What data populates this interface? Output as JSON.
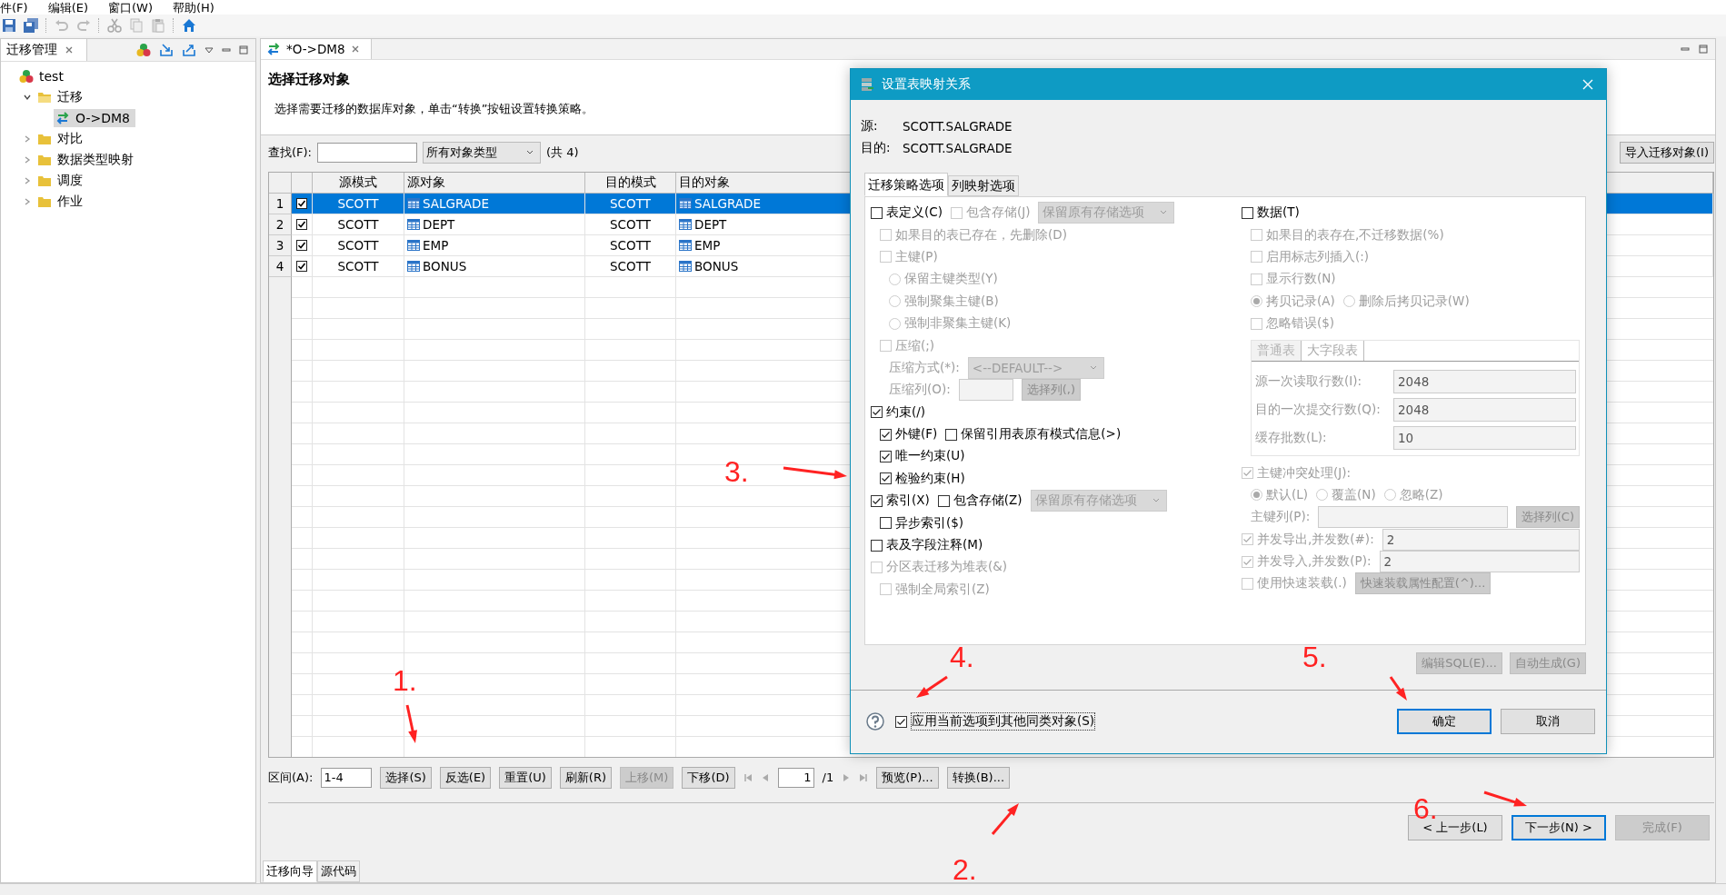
{
  "menu": [
    "件(F)",
    "编辑(E)",
    "窗口(W)",
    "帮助(H)"
  ],
  "left_panel": {
    "title": "迁移管理",
    "tree": [
      {
        "label": "test",
        "kind": "project",
        "selected": false,
        "children": [
          {
            "label": "迁移",
            "kind": "folder",
            "expanded": true,
            "selected": false,
            "children": [
              {
                "label": "O->DM8",
                "kind": "migration",
                "selected": true
              }
            ]
          },
          {
            "label": "对比",
            "kind": "folder",
            "expanded": false,
            "selected": false
          },
          {
            "label": "数据类型映射",
            "kind": "folder",
            "expanded": false,
            "selected": false
          },
          {
            "label": "调度",
            "kind": "folder",
            "expanded": false,
            "selected": false
          },
          {
            "label": "作业",
            "kind": "folder",
            "expanded": false,
            "selected": false
          }
        ]
      }
    ]
  },
  "editor": {
    "tab": "*O->DM8",
    "heading": "选择迁移对象",
    "description": "选择需要迁移的数据库对象，单击“转换”按钮设置转换策略。",
    "search_label": "查找(F):",
    "type_filter": "所有对象类型",
    "count": "(共 4)",
    "import_button": "导入迁移对象(I)"
  },
  "table": {
    "columns": [
      "源模式",
      "源对象",
      "目的模式",
      "目的对象"
    ],
    "rows": [
      {
        "index": "1",
        "checked": true,
        "selected": true,
        "source_schema": "SCOTT",
        "source_object": "SALGRADE",
        "target_schema": "SCOTT",
        "target_object": "SALGRADE"
      },
      {
        "index": "2",
        "checked": true,
        "selected": false,
        "source_schema": "SCOTT",
        "source_object": "DEPT",
        "target_schema": "SCOTT",
        "target_object": "DEPT"
      },
      {
        "index": "3",
        "checked": true,
        "selected": false,
        "source_schema": "SCOTT",
        "source_object": "EMP",
        "target_schema": "SCOTT",
        "target_object": "EMP"
      },
      {
        "index": "4",
        "checked": true,
        "selected": false,
        "source_schema": "SCOTT",
        "source_object": "BONUS",
        "target_schema": "SCOTT",
        "target_object": "BONUS"
      }
    ]
  },
  "pager": {
    "range_label": "区间(A):",
    "range_value": "1-4",
    "buttons": [
      {
        "label": "选择(S)",
        "disabled": false
      },
      {
        "label": "反选(E)",
        "disabled": false
      },
      {
        "label": "重置(U)",
        "disabled": false
      },
      {
        "label": "刷新(R)",
        "disabled": false
      },
      {
        "label": "上移(M)",
        "disabled": true
      },
      {
        "label": "下移(D)",
        "disabled": false
      }
    ],
    "page": "1",
    "pages": "/1",
    "actions": [
      {
        "label": "预览(P)...",
        "disabled": false
      },
      {
        "label": "转换(B)...",
        "disabled": false
      }
    ]
  },
  "wizard_buttons": [
    {
      "label": "< 上一步(L)",
      "disabled": false,
      "default": false
    },
    {
      "label": "下一步(N) >",
      "disabled": false,
      "default": true
    },
    {
      "label": "完成(F)",
      "disabled": true,
      "default": false
    }
  ],
  "bottom_tabs": [
    {
      "label": "迁移向导",
      "selected": true
    },
    {
      "label": "源代码",
      "selected": false
    }
  ],
  "dialog": {
    "title": "设置表映射关系",
    "source_label": "源:",
    "source": "SCOTT.SALGRADE",
    "target_label": "目的:",
    "target": "SCOTT.SALGRADE",
    "tabs": [
      {
        "label": "迁移策略选项",
        "selected": true
      },
      {
        "label": "列映射选项",
        "selected": false
      }
    ],
    "left": [
      {
        "controls": [
          {
            "kind": "checkbox",
            "label": "表定义(C)",
            "checked": false,
            "disabled": false
          },
          {
            "kind": "checkbox",
            "label": "包含存储(J)",
            "checked": false,
            "disabled": true
          },
          {
            "kind": "select",
            "value": "保留原有存储选项",
            "disabled": true
          }
        ],
        "children": [
          {
            "controls": [
              {
                "kind": "checkbox",
                "label": "如果目的表已存在，先删除(D)",
                "checked": false,
                "disabled": true
              }
            ]
          },
          {
            "controls": [
              {
                "kind": "checkbox",
                "label": "主键(P)",
                "checked": false,
                "disabled": true
              }
            ],
            "children": [
              {
                "controls": [
                  {
                    "kind": "radio",
                    "label": "保留主键类型(Y)",
                    "selected": false,
                    "disabled": true
                  }
                ]
              },
              {
                "controls": [
                  {
                    "kind": "radio",
                    "label": "强制聚集主键(B)",
                    "selected": false,
                    "disabled": true
                  }
                ]
              },
              {
                "controls": [
                  {
                    "kind": "radio",
                    "label": "强制非聚集主键(K)",
                    "selected": false,
                    "disabled": true
                  }
                ]
              }
            ]
          },
          {
            "controls": [
              {
                "kind": "checkbox",
                "label": "压缩(;)",
                "checked": false,
                "disabled": true
              }
            ],
            "children": [
              {
                "controls": [
                  {
                    "kind": "label",
                    "label": "压缩方式(*):",
                    "disabled": true
                  },
                  {
                    "kind": "select",
                    "value": "<--DEFAULT-->",
                    "disabled": true
                  }
                ]
              },
              {
                "controls": [
                  {
                    "kind": "label",
                    "label": "压缩列(O):",
                    "disabled": true
                  },
                  {
                    "kind": "input",
                    "disabled": true
                  },
                  {
                    "kind": "button",
                    "label": "选择列(,)",
                    "disabled": true
                  }
                ]
              }
            ]
          }
        ]
      },
      {
        "controls": [
          {
            "kind": "checkbox",
            "label": "约束(/)",
            "checked": true,
            "disabled": false
          }
        ],
        "children": [
          {
            "controls": [
              {
                "kind": "checkbox",
                "label": "外键(F)",
                "checked": true,
                "disabled": false
              },
              {
                "kind": "checkbox",
                "label": "保留引用表原有模式信息(>)",
                "checked": false,
                "disabled": false
              }
            ]
          },
          {
            "controls": [
              {
                "kind": "checkbox",
                "label": "唯一约束(U)",
                "checked": true,
                "disabled": false
              }
            ]
          },
          {
            "controls": [
              {
                "kind": "checkbox",
                "label": "检验约束(H)",
                "checked": true,
                "disabled": false
              }
            ]
          }
        ]
      },
      {
        "controls": [
          {
            "kind": "checkbox",
            "label": "索引(X)",
            "checked": true,
            "disabled": false
          },
          {
            "kind": "checkbox",
            "label": "包含存储(Z)",
            "checked": false,
            "disabled": false
          },
          {
            "kind": "select",
            "value": "保留原有存储选项",
            "disabled": true
          }
        ],
        "children": [
          {
            "controls": [
              {
                "kind": "checkbox",
                "label": "异步索引($)",
                "checked": false,
                "disabled": false
              }
            ]
          }
        ]
      },
      {
        "controls": [
          {
            "kind": "checkbox",
            "label": "表及字段注释(M)",
            "checked": false,
            "disabled": false
          }
        ]
      },
      {
        "controls": [
          {
            "kind": "checkbox",
            "label": "分区表迁移为堆表(&)",
            "checked": false,
            "disabled": true
          }
        ],
        "children": [
          {
            "controls": [
              {
                "kind": "checkbox",
                "label": "强制全局索引(Z)",
                "checked": false,
                "disabled": true
              }
            ]
          }
        ]
      }
    ],
    "right_top": [
      {
        "controls": [
          {
            "kind": "checkbox",
            "label": "数据(T)",
            "checked": false,
            "disabled": false
          }
        ],
        "children": [
          {
            "controls": [
              {
                "kind": "checkbox",
                "label": "如果目的表存在,不迁移数据(%)",
                "checked": false,
                "disabled": true
              }
            ]
          },
          {
            "controls": [
              {
                "kind": "checkbox",
                "label": "启用标志列插入(:)",
                "checked": false,
                "disabled": true
              }
            ]
          },
          {
            "controls": [
              {
                "kind": "checkbox",
                "label": "显示行数(N)",
                "checked": false,
                "disabled": true
              }
            ]
          },
          {
            "controls": [
              {
                "kind": "radio",
                "label": "拷贝记录(A)",
                "selected": true,
                "disabled": true
              },
              {
                "kind": "radio",
                "label": "删除后拷贝记录(W)",
                "selected": false,
                "disabled": true
              }
            ]
          },
          {
            "controls": [
              {
                "kind": "checkbox",
                "label": "忽略错误($)",
                "checked": false,
                "disabled": true
              }
            ]
          }
        ]
      }
    ],
    "batch": {
      "tabs": [
        {
          "label": "普通表",
          "selected": true
        },
        {
          "label": "大字段表",
          "selected": false
        }
      ],
      "fields": [
        {
          "label": "源一次读取行数(I):",
          "value": "2048"
        },
        {
          "label": "目的一次提交行数(Q):",
          "value": "2048"
        },
        {
          "label": "缓存批数(L):",
          "value": "10"
        }
      ]
    },
    "right_bottom": [
      {
        "controls": [
          {
            "kind": "checkbox",
            "label": "主键冲突处理(J):",
            "checked": true,
            "disabled": true
          }
        ],
        "children": [
          {
            "controls": [
              {
                "kind": "radio",
                "label": "默认(L)",
                "selected": true,
                "disabled": true
              },
              {
                "kind": "radio",
                "label": "覆盖(N)",
                "selected": false,
                "disabled": true
              },
              {
                "kind": "radio",
                "label": "忽略(Z)",
                "selected": false,
                "disabled": true
              }
            ]
          },
          {
            "controls": [
              {
                "kind": "label",
                "label": "主键列(P):",
                "disabled": true
              },
              {
                "kind": "input",
                "disabled": true
              },
              {
                "kind": "button",
                "label": "选择列(C)",
                "disabled": true
              }
            ]
          }
        ]
      },
      {
        "controls": [
          {
            "kind": "checkbox",
            "label": "并发导出,并发数(#):",
            "checked": true,
            "disabled": true
          },
          {
            "kind": "input",
            "value": "2",
            "disabled": true
          }
        ]
      },
      {
        "controls": [
          {
            "kind": "checkbox",
            "label": "并发导入,并发数(P):",
            "checked": true,
            "disabled": true
          },
          {
            "kind": "input",
            "value": "2",
            "disabled": true
          }
        ]
      },
      {
        "controls": [
          {
            "kind": "checkbox",
            "label": "使用快速装载(.)",
            "checked": false,
            "disabled": true
          },
          {
            "kind": "button",
            "label": "快速装载属性配置(^)...",
            "disabled": true
          }
        ]
      }
    ],
    "action_buttons": [
      {
        "label": "编辑SQL(E)...",
        "disabled": true
      },
      {
        "label": "自动生成(G)",
        "disabled": true
      }
    ],
    "apply_all": {
      "label": "应用当前选项到其他同类对象(S)",
      "checked": true
    },
    "footer_buttons": [
      {
        "label": "确定",
        "default": true
      },
      {
        "label": "取消",
        "default": false
      }
    ]
  },
  "annotations": [
    {
      "label": "1."
    },
    {
      "label": "2."
    },
    {
      "label": "3."
    },
    {
      "label": "4."
    },
    {
      "label": "5."
    },
    {
      "label": "6."
    }
  ]
}
